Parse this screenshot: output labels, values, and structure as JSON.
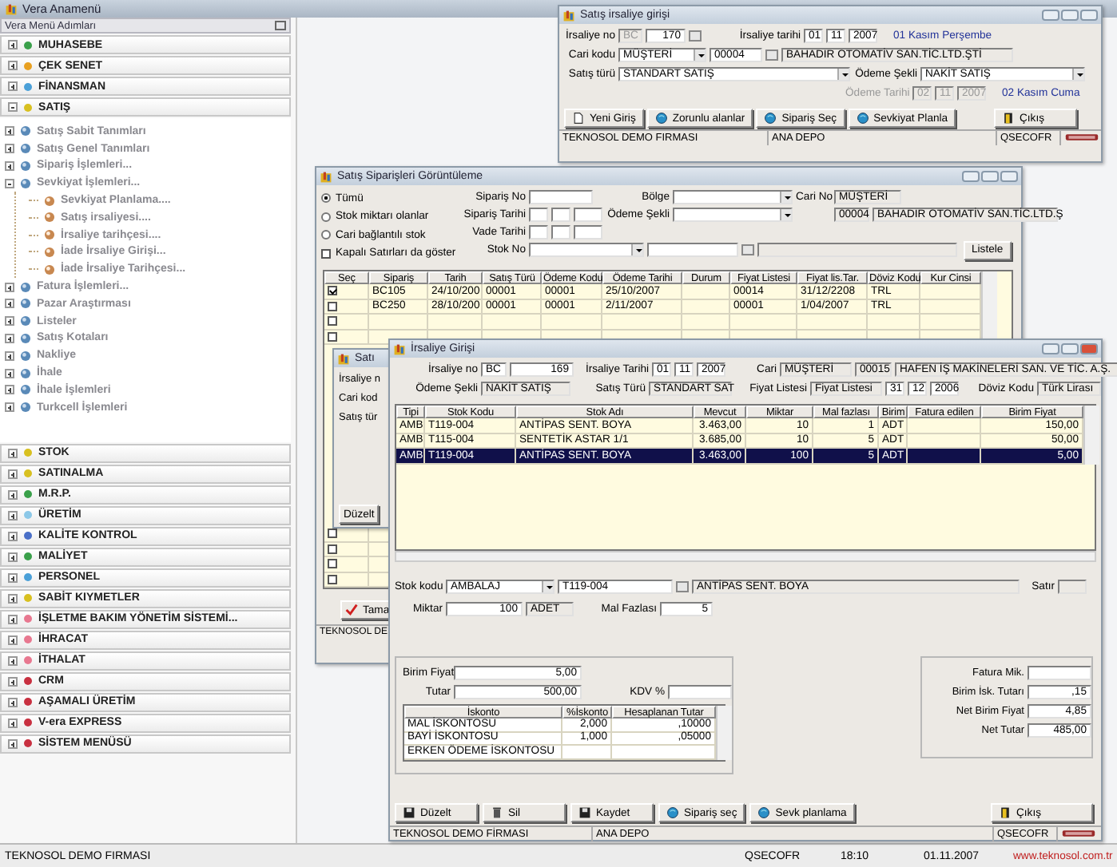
{
  "app": {
    "title": "Vera Anamenü"
  },
  "menu": {
    "title": "Vera Menü Adımları",
    "sections": [
      {
        "label": "MUHASEBE",
        "color": "#3aa04a",
        "expanded": false
      },
      {
        "label": "ÇEK SENET",
        "color": "#e8a020",
        "expanded": false
      },
      {
        "label": "FİNANSMAN",
        "color": "#4aa0d8",
        "expanded": false
      },
      {
        "label": "SATIŞ",
        "color": "#d8c020",
        "expanded": true,
        "children": [
          {
            "label": "Satış Sabit Tanımları",
            "expanded": false
          },
          {
            "label": "Satış Genel Tanımları",
            "expanded": false
          },
          {
            "label": "Sipariş İşlemleri...",
            "expanded": false
          },
          {
            "label": "Sevkiyat İşlemleri...",
            "expanded": true,
            "children": [
              {
                "label": "Sevkiyat Planlama...."
              },
              {
                "label": "Satış irsaliyesi...."
              },
              {
                "label": "İrsaliye tarihçesi...."
              },
              {
                "label": "İade İrsaliye Girişi..."
              },
              {
                "label": "İade İrsaliye Tarihçesi..."
              }
            ]
          },
          {
            "label": "Fatura İşlemleri...",
            "expanded": false
          },
          {
            "label": "Pazar Araştırması",
            "expanded": false
          },
          {
            "label": "Listeler",
            "expanded": false
          },
          {
            "label": "Satış Kotaları",
            "expanded": false
          },
          {
            "label": "Nakliye",
            "expanded": false
          },
          {
            "label": "İhale",
            "expanded": false
          },
          {
            "label": "İhale İşlemleri",
            "expanded": false
          },
          {
            "label": "Turkcell İşlemleri",
            "expanded": false
          }
        ]
      },
      {
        "label": "STOK",
        "color": "#d8c020",
        "expanded": false
      },
      {
        "label": "SATINALMA",
        "color": "#d8c020",
        "expanded": false
      },
      {
        "label": "M.R.P.",
        "color": "#3aa04a",
        "expanded": false
      },
      {
        "label": "ÜRETİM",
        "color": "#8cc8e8",
        "expanded": false
      },
      {
        "label": "KALİTE KONTROL",
        "color": "#4a70c8",
        "expanded": false
      },
      {
        "label": "MALİYET",
        "color": "#3aa04a",
        "expanded": false
      },
      {
        "label": "PERSONEL",
        "color": "#4aa0d8",
        "expanded": false
      },
      {
        "label": "SABİT KIYMETLER",
        "color": "#d8c020",
        "expanded": false
      },
      {
        "label": "İŞLETME BAKIM YÖNETİM SİSTEMİ...",
        "color": "#e87890",
        "expanded": false
      },
      {
        "label": "İHRACAT",
        "color": "#e87890",
        "expanded": false
      },
      {
        "label": "İTHALAT",
        "color": "#e87890",
        "expanded": false
      },
      {
        "label": "CRM",
        "color": "#c83040",
        "expanded": false
      },
      {
        "label": "AŞAMALI ÜRETİM",
        "color": "#c83040",
        "expanded": false
      },
      {
        "label": "V-era EXPRESS",
        "color": "#c83040",
        "expanded": false
      },
      {
        "label": "SİSTEM MENÜSÜ",
        "color": "#c83040",
        "expanded": false
      }
    ]
  },
  "shipment_entry": {
    "title": "Satış irsaliye girişi",
    "no_label": "İrsaliye no",
    "no_prefix": "BC",
    "no": "170",
    "date_label": "İrsaliye tarihi",
    "date": [
      "01",
      "11",
      "2007"
    ],
    "date_text": "01 Kasım Perşembe",
    "customer_label": "Cari kodu",
    "customer_type": "MÜŞTERİ",
    "customer_code": "00004",
    "customer_name": "BAHADIR OTOMATİV SAN.TİC.LTD.ŞTİ",
    "sale_type_label": "Satış türü",
    "sale_type": "STANDART SATIŞ",
    "payment_label": "Ödeme Şekli",
    "payment": "NAKİT SATIŞ",
    "payment_date_label": "Ödeme Tarihi",
    "payment_date": [
      "02",
      "11",
      "2007"
    ],
    "payment_date_disabled": true,
    "payment_date_text": "02 Kasım Cuma",
    "buttons": [
      {
        "label": "Yeni Giriş",
        "kind": "new"
      },
      {
        "label": "Zorunlu alanlar",
        "kind": "lookup"
      },
      {
        "label": "Sipariş Seç",
        "kind": "lookup"
      },
      {
        "label": "Sevkiyat Planla",
        "kind": "lookup"
      },
      {
        "label": "Çıkış",
        "kind": "exit"
      }
    ],
    "status": [
      "TEKNOSOL DEMO FIRMASI",
      "ANA DEPO",
      "QSECOFR"
    ]
  },
  "orders_window": {
    "title": "Satış Siparişleri Görüntüleme",
    "options": [
      {
        "label": "Tümü",
        "selected": true
      },
      {
        "label": "Stok miktarı olanlar",
        "selected": false
      },
      {
        "label": "Cari bağlantılı stok",
        "selected": false
      }
    ],
    "closed_rows": {
      "label": "Kapalı Satırları da göster",
      "checked": false
    },
    "order_no_label": "Sipariş No",
    "order_date_label": "Sipariş Tarihi",
    "due_date_label": "Vade Tarihi",
    "stock_label": "Stok No",
    "region_label": "Bölge",
    "payment_label": "Ödeme Şekli",
    "customer_label": "Cari No",
    "customer_type": "MÜŞTERİ",
    "customer_code": "00004",
    "customer_name": "BAHADIR OTOMATİV SAN.TİC.LTD.Ş",
    "list_button": "Listele",
    "table": {
      "columns": [
        "Seç",
        "Sipariş",
        "Tarih",
        "Satış Türü",
        "Ödeme Kodu",
        "Ödeme Tarihi",
        "Durum",
        "Fiyat Listesi",
        "Fiyat lis.Tar.",
        "Döviz Kodu",
        "Kur Cinsi"
      ],
      "rows": [
        {
          "checked": true,
          "cells": [
            "BC105",
            "24/10/200",
            "00001",
            "00001",
            "25/10/2007",
            null,
            "00014",
            "31/12/2208",
            "TRL",
            null
          ]
        },
        {
          "checked": false,
          "cells": [
            "BC250",
            "28/10/200",
            "00001",
            "00001",
            "2/11/2007",
            null,
            "00001",
            "1/04/2007",
            "TRL",
            null
          ]
        },
        {
          "checked": false
        },
        {
          "checked": false
        },
        {
          "checked": false
        },
        {
          "checked": false
        },
        {
          "checked": false
        },
        {
          "checked": false
        }
      ]
    },
    "ok_button": "Tama",
    "status": "TEKNOSOL DE"
  },
  "back_window": {
    "title": "Satı",
    "labels": [
      "İrsaliye n",
      "Cari kod",
      "Satış tür"
    ],
    "button": "Düzelt"
  },
  "waybill_entry": {
    "title": "İrsaliye Girişi",
    "header": {
      "no_label": "İrsaliye no",
      "no_prefix": "BC",
      "no": "169",
      "date_label": "İrsaliye Tarihi",
      "date": [
        "01",
        "11",
        "2007"
      ],
      "customer_label": "Cari",
      "customer_type": "MÜŞTERİ",
      "customer_code": "00015",
      "customer_name": "HAFEN İŞ MAKİNELERİ SAN. VE TİC. A.Ş.",
      "payment_label": "Ödeme Şekli",
      "payment": "NAKİT SATIŞ",
      "sale_type_label": "Satış Türü",
      "sale_type": "STANDART SAT",
      "price_list_label": "Fiyat Listesi",
      "price_list": "Fiyat Listesi",
      "price_list_date": [
        "31",
        "12",
        "2006"
      ],
      "currency_label": "Döviz Kodu",
      "currency": "Türk Lirası"
    },
    "table": {
      "columns": [
        "Tipi",
        "Stok Kodu",
        "Stok Adı",
        "Mevcut",
        "Miktar",
        "Mal fazlası",
        "Birim",
        "Fatura edilen",
        "Birim Fiyat"
      ],
      "rows": [
        {
          "selected": false,
          "cells": [
            "AMB",
            "T119-004",
            "ANTİPAS SENT. BOYA",
            "3.463,00",
            "10",
            "1",
            "ADT",
            null,
            "150,00"
          ]
        },
        {
          "selected": false,
          "cells": [
            "AMB",
            "T115-004",
            "SENTETİK ASTAR 1/1",
            "3.685,00",
            "10",
            "5",
            "ADT",
            null,
            "50,00"
          ]
        },
        {
          "selected": true,
          "cells": [
            "AMB",
            "T119-004",
            "ANTİPAS SENT. BOYA",
            "3.463,00",
            "100",
            "5",
            "ADT",
            null,
            "5,00"
          ]
        }
      ]
    },
    "item": {
      "stock_label": "Stok kodu",
      "stock_group": "AMBALAJ",
      "stock_code": "T119-004",
      "stock_name": "ANTİPAS SENT. BOYA",
      "line_label": "Satır",
      "qty_label": "Miktar",
      "qty": "100",
      "unit": "ADET",
      "bonus_label": "Mal Fazlası",
      "bonus": "5"
    },
    "pricing": {
      "unit_price_label": "Birim Fiyat",
      "unit_price": "5,00",
      "amount_label": "Tutar",
      "amount": "500,00",
      "vat_label": "KDV %",
      "discounts": {
        "columns": [
          "İskonto",
          "%İskonto",
          "Hesaplanan Tutar"
        ],
        "rows": [
          [
            "MAL İSKONTOSU",
            "2,000",
            ",10000"
          ],
          [
            "BAYİ İSKONTOSU",
            "1,000",
            ",05000"
          ],
          [
            "ERKEN ÖDEME İSKONTOSU",
            null,
            null
          ]
        ]
      }
    },
    "totals": [
      {
        "label": "Fatura Mik."
      },
      {
        "label": "Birim İsk. Tutarı",
        "value": ",15"
      },
      {
        "label": "Net Birim Fiyat",
        "value": "4,85"
      },
      {
        "label": "Net Tutar",
        "value": "485,00"
      }
    ],
    "buttons": [
      {
        "label": "Düzelt",
        "kind": "save"
      },
      {
        "label": "Sil",
        "kind": "delete"
      },
      {
        "label": "Kaydet",
        "kind": "save"
      },
      {
        "label": "Sipariş seç",
        "kind": "lookup"
      },
      {
        "label": "Sevk planlama",
        "kind": "lookup"
      },
      {
        "label": "Çıkış",
        "kind": "exit"
      }
    ],
    "status": [
      "TEKNOSOL DEMO FİRMASI",
      "ANA DEPO",
      "QSECOFR"
    ]
  },
  "status_bar": {
    "company": "TEKNOSOL DEMO FIRMASI",
    "user": "QSECOFR",
    "time": "18:10",
    "date": "01.11.2007",
    "website": "www.teknosol.com.tr"
  }
}
